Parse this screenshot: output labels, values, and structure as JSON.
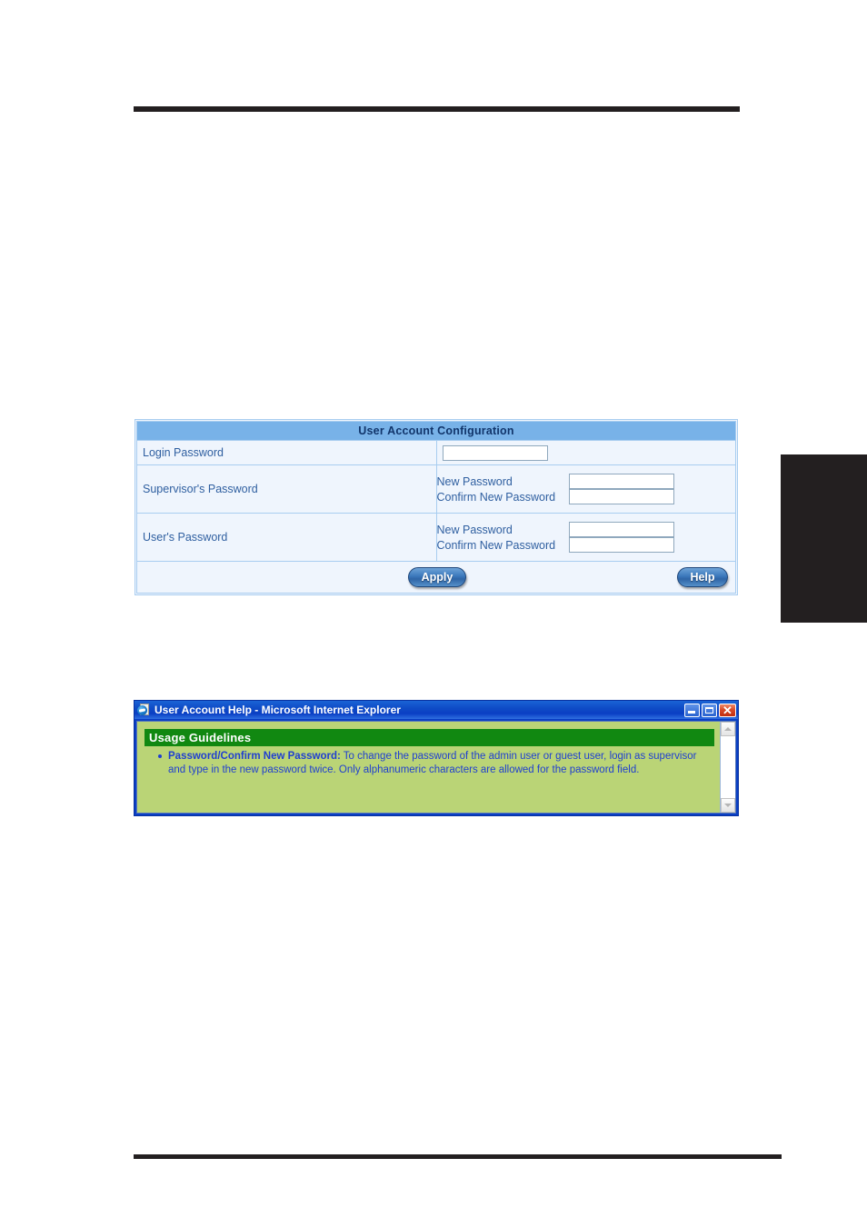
{
  "page": {
    "rules": {
      "top": "horizontal-rule",
      "bottom": "horizontal-rule"
    },
    "thumb_tab": ""
  },
  "config_panel": {
    "title": "User Account Configuration",
    "rows": {
      "login": {
        "label": "Login Password",
        "field_value": "",
        "placeholder": ""
      },
      "supervisor": {
        "label": "Supervisor's Password",
        "new_label": "New Password",
        "new_value": "",
        "confirm_label": "Confirm New Password",
        "confirm_value": ""
      },
      "user": {
        "label": "User's Password",
        "new_label": "New Password",
        "new_value": "",
        "confirm_label": "Confirm New Password",
        "confirm_value": ""
      }
    },
    "buttons": {
      "apply": "Apply",
      "help": "Help"
    },
    "colors": {
      "header_bg": "#78b2e8",
      "header_text": "#11356b",
      "body_bg": "#eff5fd",
      "border": "#a8cdf0",
      "button_blue": "#3b78bb"
    }
  },
  "help_window": {
    "title": "User Account Help - Microsoft Internet Explorer",
    "icon": "ie-page-icon",
    "window_buttons": {
      "minimize": "minimize-button",
      "maximize": "maximize-button",
      "close": "✕"
    },
    "section_title": "Usage Guidelines",
    "items": [
      {
        "term": "Password/Confirm New Password:",
        "text": " To change the password of the admin user or guest user, login as supervisor and type in the new password twice. Only alphanumeric characters are allowed for the password field."
      }
    ],
    "colors": {
      "titlebar": "#0a3fc4",
      "body_bg": "#bad476",
      "section_bg": "#118811",
      "text": "#1f3fd0"
    }
  }
}
